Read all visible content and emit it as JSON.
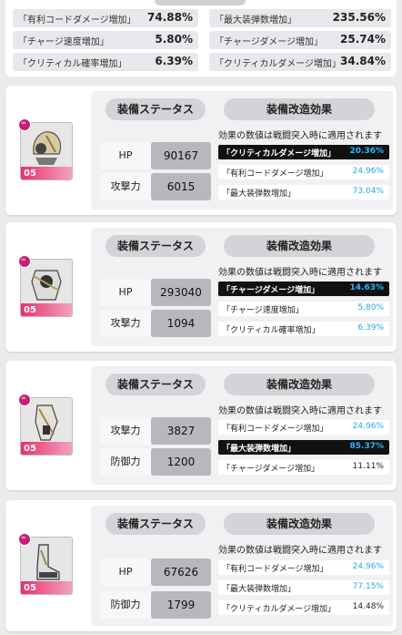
{
  "summary": {
    "rows": [
      {
        "left": {
          "label": "「有利コードダメージ増加」",
          "value": "74.88%"
        },
        "right": {
          "label": "「最大装弾数増加」",
          "value": "235.56%"
        }
      },
      {
        "left": {
          "label": "「チャージ速度増加」",
          "value": "5.80%"
        },
        "right": {
          "label": "「チャージダメージ増加」",
          "value": "25.74%"
        }
      },
      {
        "left": {
          "label": "「クリティカル確率増加」",
          "value": "6.39%"
        },
        "right": {
          "label": "「クリティカルダメージ増加」",
          "value": "34.84%"
        }
      }
    ]
  },
  "common": {
    "status_title": "装備ステータス",
    "mod_title": "装備改造効果",
    "note": "効果の数値は戦闘突入時に適用されます",
    "level": "05"
  },
  "cards": [
    {
      "icon": "helmet-icon",
      "stats": [
        {
          "label": "HP",
          "value": "90167"
        },
        {
          "label": "攻撃力",
          "value": "6015"
        }
      ],
      "effects": [
        {
          "label": "「クリティカルダメージ増加」",
          "value": "20.36%",
          "highlight": true
        },
        {
          "label": "「有利コードダメージ増加」",
          "value": "24.96%",
          "highlight": false
        },
        {
          "label": "「最大装弾数増加」",
          "value": "73.04%",
          "highlight": false
        }
      ]
    },
    {
      "icon": "armor-icon",
      "stats": [
        {
          "label": "HP",
          "value": "293040"
        },
        {
          "label": "攻撃力",
          "value": "1094"
        }
      ],
      "effects": [
        {
          "label": "「チャージダメージ増加」",
          "value": "14.63%",
          "highlight": true
        },
        {
          "label": "「チャージ速度増加」",
          "value": "5.80%",
          "highlight": false
        },
        {
          "label": "「クリティカル確率増加」",
          "value": "6.39%",
          "highlight": false
        }
      ]
    },
    {
      "icon": "gauntlet-icon",
      "stats": [
        {
          "label": "攻撃力",
          "value": "3827"
        },
        {
          "label": "防御力",
          "value": "1200"
        }
      ],
      "effects": [
        {
          "label": "「有利コードダメージ増加」",
          "value": "24.96%",
          "highlight": false
        },
        {
          "label": "「最大装弾数増加」",
          "value": "85.37%",
          "highlight": true
        },
        {
          "label": "「チャージダメージ増加」",
          "value": "11.11%",
          "highlight": false,
          "dark": true
        }
      ]
    },
    {
      "icon": "boots-icon",
      "stats": [
        {
          "label": "HP",
          "value": "67626"
        },
        {
          "label": "防御力",
          "value": "1799"
        }
      ],
      "effects": [
        {
          "label": "「有利コードダメージ増加」",
          "value": "24.96%",
          "highlight": false
        },
        {
          "label": "「最大装弾数増加」",
          "value": "77.15%",
          "highlight": false
        },
        {
          "label": "「クリティカルダメージ増加」",
          "value": "14.48%",
          "highlight": false,
          "dark": true
        }
      ]
    }
  ]
}
